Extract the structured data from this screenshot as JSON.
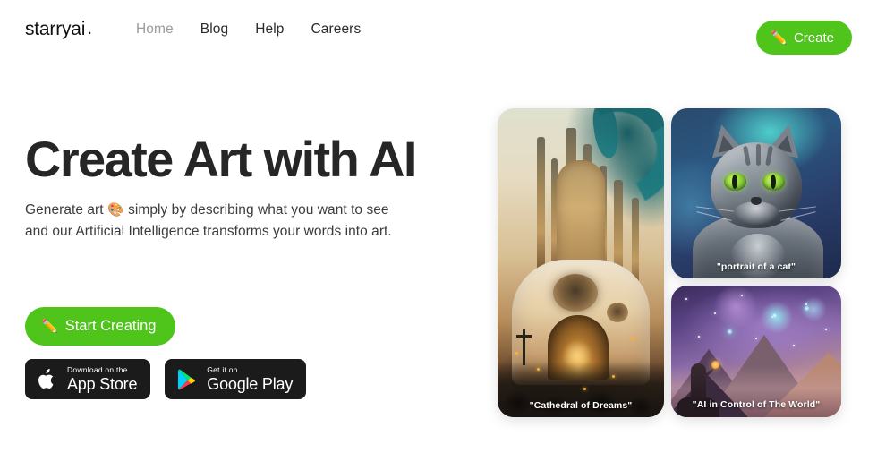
{
  "header": {
    "logo": "starryai",
    "logo_dot": ".",
    "nav": [
      {
        "label": "Home",
        "active": true
      },
      {
        "label": "Blog",
        "active": false
      },
      {
        "label": "Help",
        "active": false
      },
      {
        "label": "Careers",
        "active": false
      }
    ],
    "create_button": {
      "label": "Create",
      "icon": "pencil-emoji",
      "icon_glyph": "✏️",
      "color": "#4fc41b"
    }
  },
  "hero": {
    "title": "Create Art with AI",
    "subtitle_line1_pre": "Generate art ",
    "subtitle_emoji": "🎨",
    "subtitle_line1_post": " simply by describing what you want to see",
    "subtitle_line2": "and our Artificial Intelligence transforms your words into art.",
    "start_button": {
      "label": "Start Creating",
      "icon": "pencil-emoji",
      "icon_glyph": "✏️",
      "color": "#4fc41b"
    },
    "stores": [
      {
        "icon": "apple-icon",
        "top_label": "Download on the",
        "bottom_label": "App Store"
      },
      {
        "icon": "google-play-icon",
        "top_label": "Get it on",
        "bottom_label": "Google Play"
      }
    ]
  },
  "gallery": {
    "cards": [
      {
        "id": "cathedral",
        "caption": "\"Cathedral of Dreams\"",
        "alt": "ornate golden cathedral under a teal sky"
      },
      {
        "id": "cat",
        "caption": "\"portrait of a cat\"",
        "alt": "grey tabby cat with green eyes on blue background"
      },
      {
        "id": "space",
        "caption": "\"AI in Control of The World\"",
        "alt": "figure on mountain beneath a purple nebula"
      }
    ]
  },
  "colors": {
    "accent_green": "#4fc41b",
    "text_dark": "#262626",
    "text_muted": "#9b9b9b",
    "badge_black": "#1b1b1b",
    "background": "#ffffff"
  }
}
